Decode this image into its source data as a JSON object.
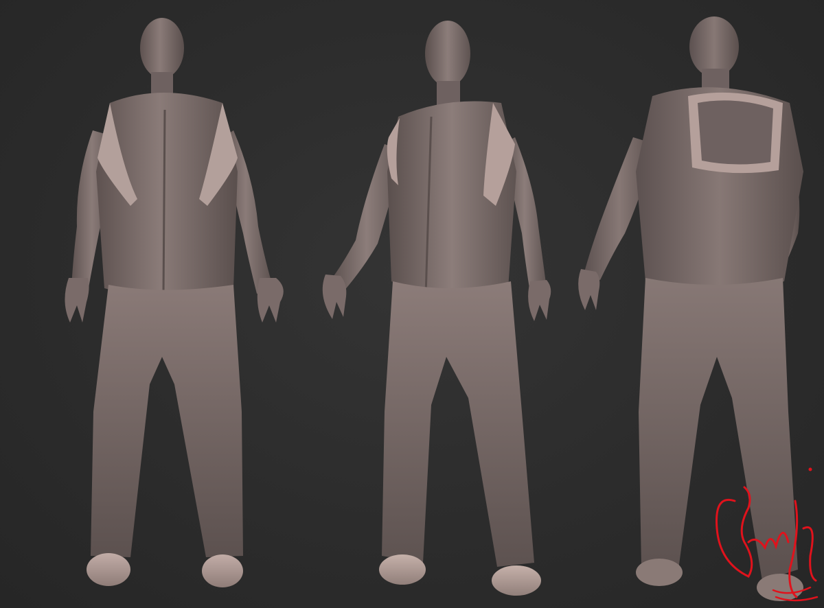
{
  "scene": {
    "background_color": "#2b2b2b",
    "clay_color": "#7d6e6c",
    "clay_highlight": "#a89592",
    "clay_shadow": "#4e4443",
    "vest_color": "#b5a09b",
    "signature_color": "#e0121c",
    "views": [
      {
        "id": "front",
        "view": "front"
      },
      {
        "id": "three-quarter",
        "view": "three-quarter"
      },
      {
        "id": "back",
        "view": "back"
      }
    ]
  },
  "signature": {
    "icon": "handwritten-signature"
  }
}
